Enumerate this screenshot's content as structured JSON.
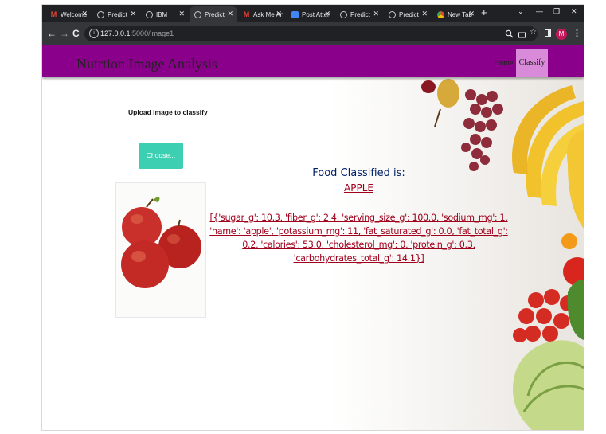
{
  "browser": {
    "tabs": [
      {
        "label": "Welcome",
        "icon": "gmail-icon",
        "active": false
      },
      {
        "label": "Predict",
        "icon": "globe-icon",
        "active": false
      },
      {
        "label": "IBM",
        "icon": "globe-icon",
        "active": false
      },
      {
        "label": "Predict",
        "icon": "globe-icon",
        "active": true
      },
      {
        "label": "Ask Me An",
        "icon": "gmail-icon",
        "active": false
      },
      {
        "label": "Post Atten",
        "icon": "docs-icon",
        "active": false
      },
      {
        "label": "Predict",
        "icon": "globe-icon",
        "active": false
      },
      {
        "label": "Predict",
        "icon": "globe-icon",
        "active": false
      },
      {
        "label": "New Tab",
        "icon": "chrome-icon",
        "active": false
      }
    ],
    "new_tab_symbol": "+",
    "url_host": "127.0.0.1",
    "url_path": ":5000/image1",
    "profile_initial": "M"
  },
  "navbar": {
    "brand": "Nutrtion Image Analysis",
    "links": {
      "home": "Home",
      "classify": "Classify"
    },
    "color": "#8b008b",
    "active_color": "#d98ad9"
  },
  "upload": {
    "title": "Upload image to classify",
    "button_label": "Choose..."
  },
  "result": {
    "heading": "Food Classified is:",
    "food": "APPLE",
    "nutrition": "[{'sugar_g': 10.3, 'fiber_g': 2.4, 'serving_size_g': 100.0, 'sodium_mg': 1, 'name': 'apple', 'potassium_mg': 11, 'fat_saturated_g': 0.0, 'fat_total_g': 0.2, 'calories': 53.0, 'cholesterol_mg': 0, 'protein_g': 0.3, 'carbohydrates_total_g': 14.1}]"
  },
  "colors": {
    "accent": "#3ccfb1",
    "heading": "#001f66",
    "result_text": "#a0001b"
  }
}
